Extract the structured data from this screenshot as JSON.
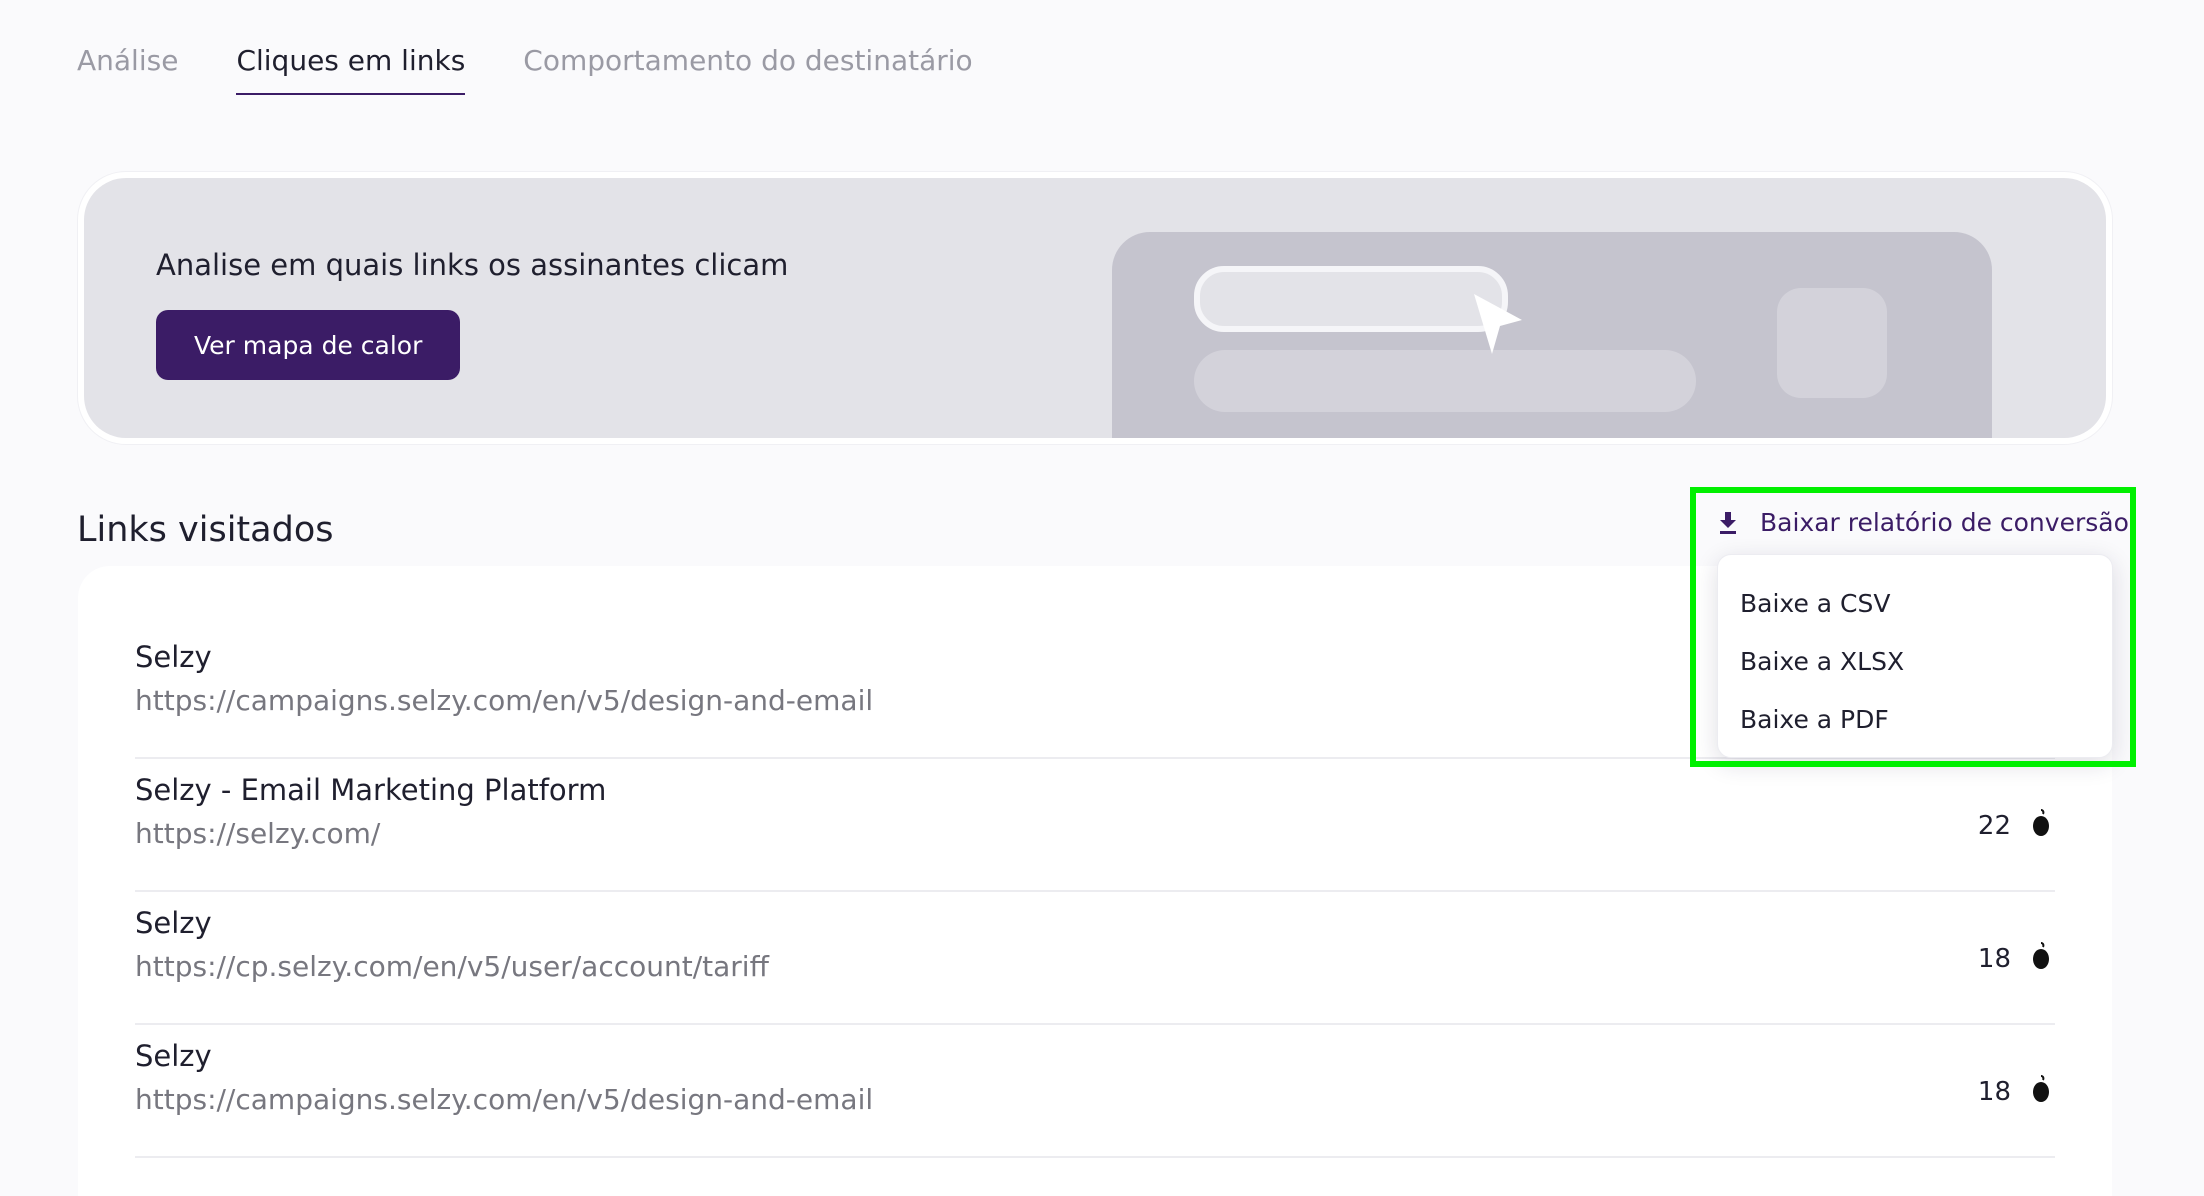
{
  "tabs": [
    {
      "label": "Análise",
      "active": false
    },
    {
      "label": "Cliques em links",
      "active": true
    },
    {
      "label": "Comportamento do destinatário",
      "active": false
    }
  ],
  "banner": {
    "title": "Analise em quais links os assinantes clicam",
    "button_label": "Ver mapa de calor"
  },
  "links_section": {
    "title": "Links visitados",
    "download_label": "Baixar relatório de conversão",
    "download_icon": "download-icon",
    "dropdown": [
      "Baixe a CSV",
      "Baixe a XLSX",
      "Baixe a PDF"
    ]
  },
  "rows": [
    {
      "title": "Selzy",
      "url": "https://campaigns.selzy.com/en/v5/design-and-email",
      "count": "",
      "icon": "mouse-icon"
    },
    {
      "title": "Selzy - Email Marketing Platform",
      "url": "https://selzy.com/",
      "count": "22",
      "icon": "mouse-icon"
    },
    {
      "title": "Selzy",
      "url": "https://cp.selzy.com/en/v5/user/account/tariff",
      "count": "18",
      "icon": "mouse-icon"
    },
    {
      "title": "Selzy",
      "url": "https://campaigns.selzy.com/en/v5/design-and-email",
      "count": "18",
      "icon": "mouse-icon"
    }
  ],
  "colors": {
    "accent": "#3b1c66",
    "highlight": "#00f000",
    "banner_bg": "#e3e3e8"
  }
}
